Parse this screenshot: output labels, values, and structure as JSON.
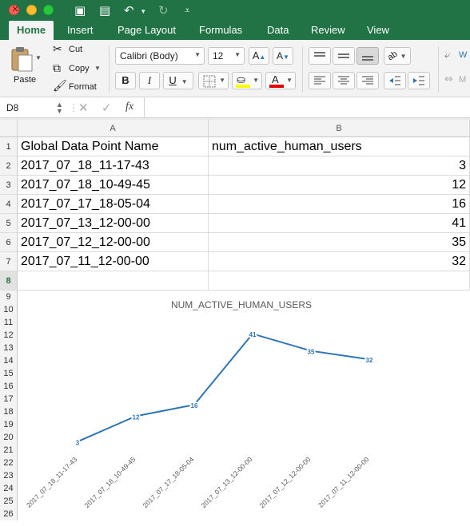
{
  "ribbon_tabs": [
    "Home",
    "Insert",
    "Page Layout",
    "Formulas",
    "Data",
    "Review",
    "View"
  ],
  "clipboard": {
    "paste": "Paste",
    "cut": "Cut",
    "copy": "Copy",
    "format": "Format"
  },
  "font": {
    "name": "Calibri (Body)",
    "size": "12",
    "bold": "B",
    "italic": "I",
    "underline": "U"
  },
  "formula_bar": {
    "cell_ref": "D8",
    "fx": "fx",
    "value": ""
  },
  "columns": [
    "A",
    "B"
  ],
  "rows": [
    {
      "num": "1",
      "a": "Global Data Point Name",
      "b": "num_active_human_users"
    },
    {
      "num": "2",
      "a": "2017_07_18_11-17-43",
      "b": "3"
    },
    {
      "num": "3",
      "a": "2017_07_18_10-49-45",
      "b": "12"
    },
    {
      "num": "4",
      "a": "2017_07_17_18-05-04",
      "b": "16"
    },
    {
      "num": "5",
      "a": "2017_07_13_12-00-00",
      "b": "41"
    },
    {
      "num": "6",
      "a": "2017_07_12_12-00-00",
      "b": "35"
    },
    {
      "num": "7",
      "a": "2017_07_11_12-00-00",
      "b": "32"
    },
    {
      "num": "8",
      "a": "",
      "b": ""
    }
  ],
  "extra_rows": [
    "9",
    "10",
    "11",
    "12",
    "13",
    "14",
    "15",
    "16",
    "17",
    "18",
    "19",
    "20",
    "21",
    "22",
    "23",
    "24",
    "25",
    "26"
  ],
  "colors": {
    "accent": "#217346",
    "series": "#2e75b6"
  },
  "chart_data": {
    "type": "line",
    "title": "NUM_ACTIVE_HUMAN_USERS",
    "categories": [
      "2017_07_18_11-17-43",
      "2017_07_18_10-49-45",
      "2017_07_17_18-05-04",
      "2017_07_13_12-00-00",
      "2017_07_12_12-00-00",
      "2017_07_11_12-00-00"
    ],
    "values": [
      3,
      12,
      16,
      41,
      35,
      32
    ],
    "ylim": [
      0,
      45
    ],
    "grid": false,
    "data_labels": true
  }
}
